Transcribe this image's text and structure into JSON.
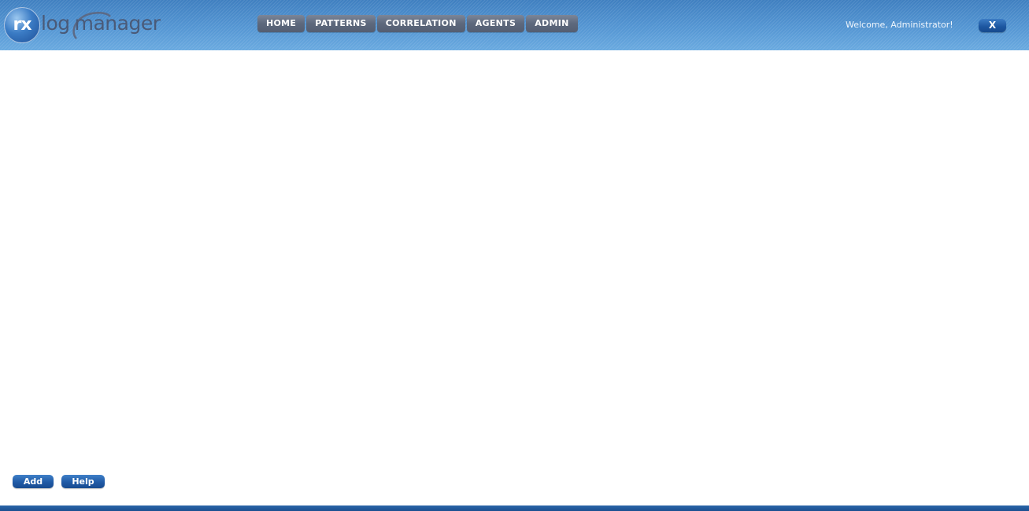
{
  "app": {
    "logo_badge": "rx",
    "logo_text_part1": "log",
    "logo_text_part2": "manager"
  },
  "nav": {
    "items": [
      {
        "label": "HOME"
      },
      {
        "label": "PATTERNS"
      },
      {
        "label": "CORRELATION"
      },
      {
        "label": "AGENTS"
      },
      {
        "label": "ADMIN"
      }
    ]
  },
  "user": {
    "welcome_text": "Welcome, Administrator!",
    "logout_label": "X"
  },
  "actions": {
    "add_label": "Add",
    "help_label": "Help"
  },
  "colors": {
    "header_blue": "#5496d3",
    "nav_button": "#5d687c",
    "action_button": "#205ba6",
    "footer_bar": "#1c4f90"
  }
}
